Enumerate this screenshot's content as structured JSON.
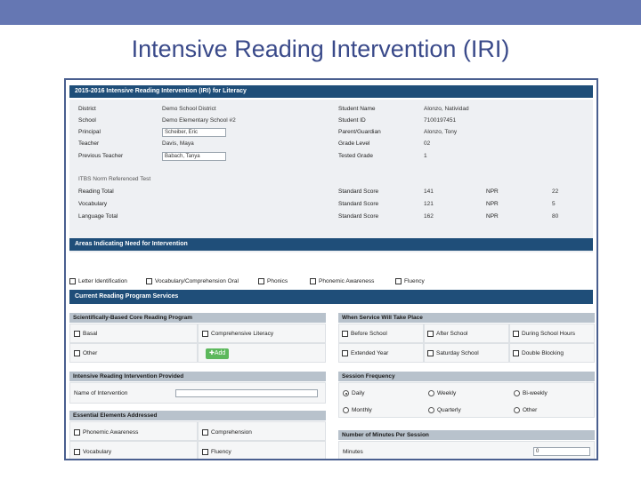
{
  "slide_title": "Intensive Reading Intervention (IRI)",
  "form_title": "2015-2016 Intensive Reading Intervention (IRI) for Literacy",
  "info": {
    "left": [
      {
        "label": "District",
        "value": "Demo School District"
      },
      {
        "label": "School",
        "value": "Demo Elementary School #2"
      },
      {
        "label": "Principal",
        "value": "Scheiber, Eric"
      },
      {
        "label": "Teacher",
        "value": "Davis, Maya"
      },
      {
        "label": "Previous Teacher",
        "value": "Babach, Tanya"
      }
    ],
    "right": [
      {
        "label": "Student Name",
        "value": "Alonzo, Natividad"
      },
      {
        "label": "Student ID",
        "value": "7100197451"
      },
      {
        "label": "Parent/Guardian",
        "value": "Alonzo, Tony"
      },
      {
        "label": "Grade Level",
        "value": "02"
      },
      {
        "label": "Tested Grade",
        "value": "1"
      }
    ],
    "section_label": "ITBS Norm Referenced Test",
    "scores": [
      {
        "label": "Reading Total",
        "score_label": "Standard Score",
        "score": "141",
        "npr_label": "NPR",
        "npr": "22"
      },
      {
        "label": "Vocabulary",
        "score_label": "Standard Score",
        "score": "121",
        "npr_label": "NPR",
        "npr": "5"
      },
      {
        "label": "Language Total",
        "score_label": "Standard Score",
        "score": "162",
        "npr_label": "NPR",
        "npr": "80"
      }
    ]
  },
  "areas": {
    "title": "Areas Indicating Need for Intervention",
    "items": [
      "Letter Identification",
      "Vocabulary/Comprehension Oral",
      "Phonics",
      "Phonemic Awareness",
      "Fluency"
    ]
  },
  "current": {
    "title": "Current Reading Program Services",
    "program": {
      "title": "Scientifically-Based Core Reading Program",
      "items": [
        "Basal",
        "Comprehensive Literacy",
        "Other"
      ],
      "add_label": "✚Add"
    },
    "when": {
      "title": "When Service Will Take Place",
      "items": [
        "Before School",
        "After School",
        "During School Hours",
        "Extended Year",
        "Saturday School",
        "Double Blocking"
      ]
    },
    "iri": {
      "title": "Intensive Reading Intervention Provided",
      "field_label": "Name of Intervention"
    },
    "frequency": {
      "title": "Session Frequency",
      "options": [
        "Daily",
        "Weekly",
        "Bi-weekly",
        "Monthly",
        "Quarterly",
        "Other"
      ],
      "selected": "Daily"
    },
    "elements": {
      "title": "Essential Elements Addressed",
      "items": [
        "Phonemic Awareness",
        "Comprehension",
        "Vocabulary",
        "Fluency"
      ]
    },
    "minutes": {
      "title": "Number of Minutes Per Session",
      "field_label": "Minutes",
      "value": "0"
    }
  },
  "colors": {
    "top_bar": "#6577b3",
    "section_bar": "#1f4e79",
    "sub_bar": "#b8c2cc",
    "title_text": "#3a4a8a",
    "add_button": "#5cb85c"
  }
}
